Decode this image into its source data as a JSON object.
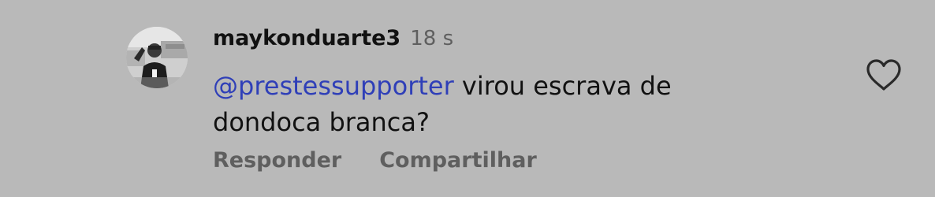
{
  "comment": {
    "username": "maykonduarte3",
    "timestamp": "18 s",
    "mention": "@prestessupporter",
    "text": " virou escrava de dondoca branca?",
    "reply_label": "Responder",
    "share_label": "Compartilhar"
  },
  "icons": {
    "avatar": "profile-photo",
    "like": "heart-outline-icon"
  },
  "colors": {
    "background": "#b9b9b9",
    "mention": "#2f3fb8",
    "secondary_text": "#5f5f5f",
    "primary_text": "#111111"
  }
}
